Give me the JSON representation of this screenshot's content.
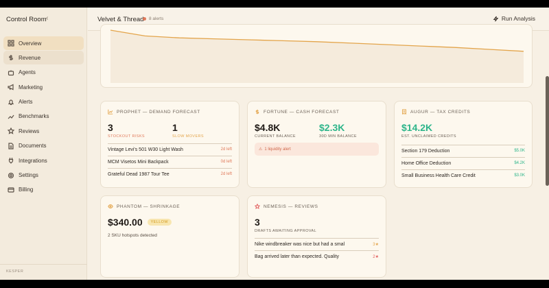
{
  "sidebar": {
    "brand": "Control Room",
    "collapse_icon": "chevron-left-icon",
    "items": [
      {
        "label": "Overview",
        "icon": "grid-icon"
      },
      {
        "label": "Revenue",
        "icon": "dollar-icon"
      },
      {
        "label": "Agents",
        "icon": "bot-icon"
      },
      {
        "label": "Marketing",
        "icon": "megaphone-icon"
      },
      {
        "label": "Alerts",
        "icon": "bell-icon"
      },
      {
        "label": "Benchmarks",
        "icon": "chart-icon"
      },
      {
        "label": "Reviews",
        "icon": "star-icon"
      },
      {
        "label": "Documents",
        "icon": "document-icon"
      },
      {
        "label": "Integrations",
        "icon": "plug-icon"
      },
      {
        "label": "Settings",
        "icon": "gear-icon"
      },
      {
        "label": "Billing",
        "icon": "card-icon"
      }
    ],
    "footer": "KESPER"
  },
  "header": {
    "title": "Velvet & Thread",
    "alerts": "8 alerts",
    "run_label": "Run Analysis"
  },
  "chart_data": {
    "type": "area",
    "x": [
      0,
      1,
      2,
      3,
      4,
      5,
      6,
      7,
      8,
      9,
      10,
      11,
      12
    ],
    "values": [
      100,
      88,
      84,
      82,
      80,
      78,
      76,
      73,
      70,
      67,
      64,
      60,
      56
    ]
  },
  "prophet": {
    "title": "PROPHET — DEMAND FORECAST",
    "stat1": {
      "value": "3",
      "label": "STOCKOUT RISKS"
    },
    "stat2": {
      "value": "1",
      "label": "SLOW MOVERS"
    },
    "rows": [
      {
        "name": "Vintage Levi's 501 W30 Light Wash",
        "status": "2d left"
      },
      {
        "name": "MCM Visetos Mini Backpack",
        "status": "0d left"
      },
      {
        "name": "Grateful Dead 1987 Tour Tee",
        "status": "2d left"
      }
    ]
  },
  "fortune": {
    "title": "FORTUNE — CASH FORECAST",
    "stat1": {
      "value": "$4.8K",
      "label": "CURRENT BALANCE"
    },
    "stat2": {
      "value": "$2.3K",
      "label": "30D MIN BALANCE"
    },
    "alert": "1 liquidity alert"
  },
  "augur": {
    "title": "AUGUR — TAX CREDITS",
    "value": "$14.2K",
    "label": "EST. UNCLAIMED CREDITS",
    "rows": [
      {
        "name": "Section 179 Deduction",
        "amount": "$5.0K"
      },
      {
        "name": "Home Office Deduction",
        "amount": "$4.2K"
      },
      {
        "name": "Small Business Health Care Credit",
        "amount": "$3.0K"
      }
    ]
  },
  "phantom": {
    "title": "PHANTOM — SHRINKAGE",
    "value": "$340.00",
    "badge": "YELLOW",
    "note": "2 SKU hotspots detected"
  },
  "nemesis": {
    "title": "NEMESIS — REVIEWS",
    "value": "3",
    "label": "DRAFTS AWAITING APPROVAL",
    "rows": [
      {
        "text": "Nike windbreaker was nice but had a smal",
        "stars": "3★"
      },
      {
        "text": "Bag arrived later than expected. Quality",
        "stars": "2★"
      }
    ]
  },
  "colors": {
    "accent_orange": "#e3a44a",
    "green": "#2db58a",
    "red": "#e0795a"
  }
}
